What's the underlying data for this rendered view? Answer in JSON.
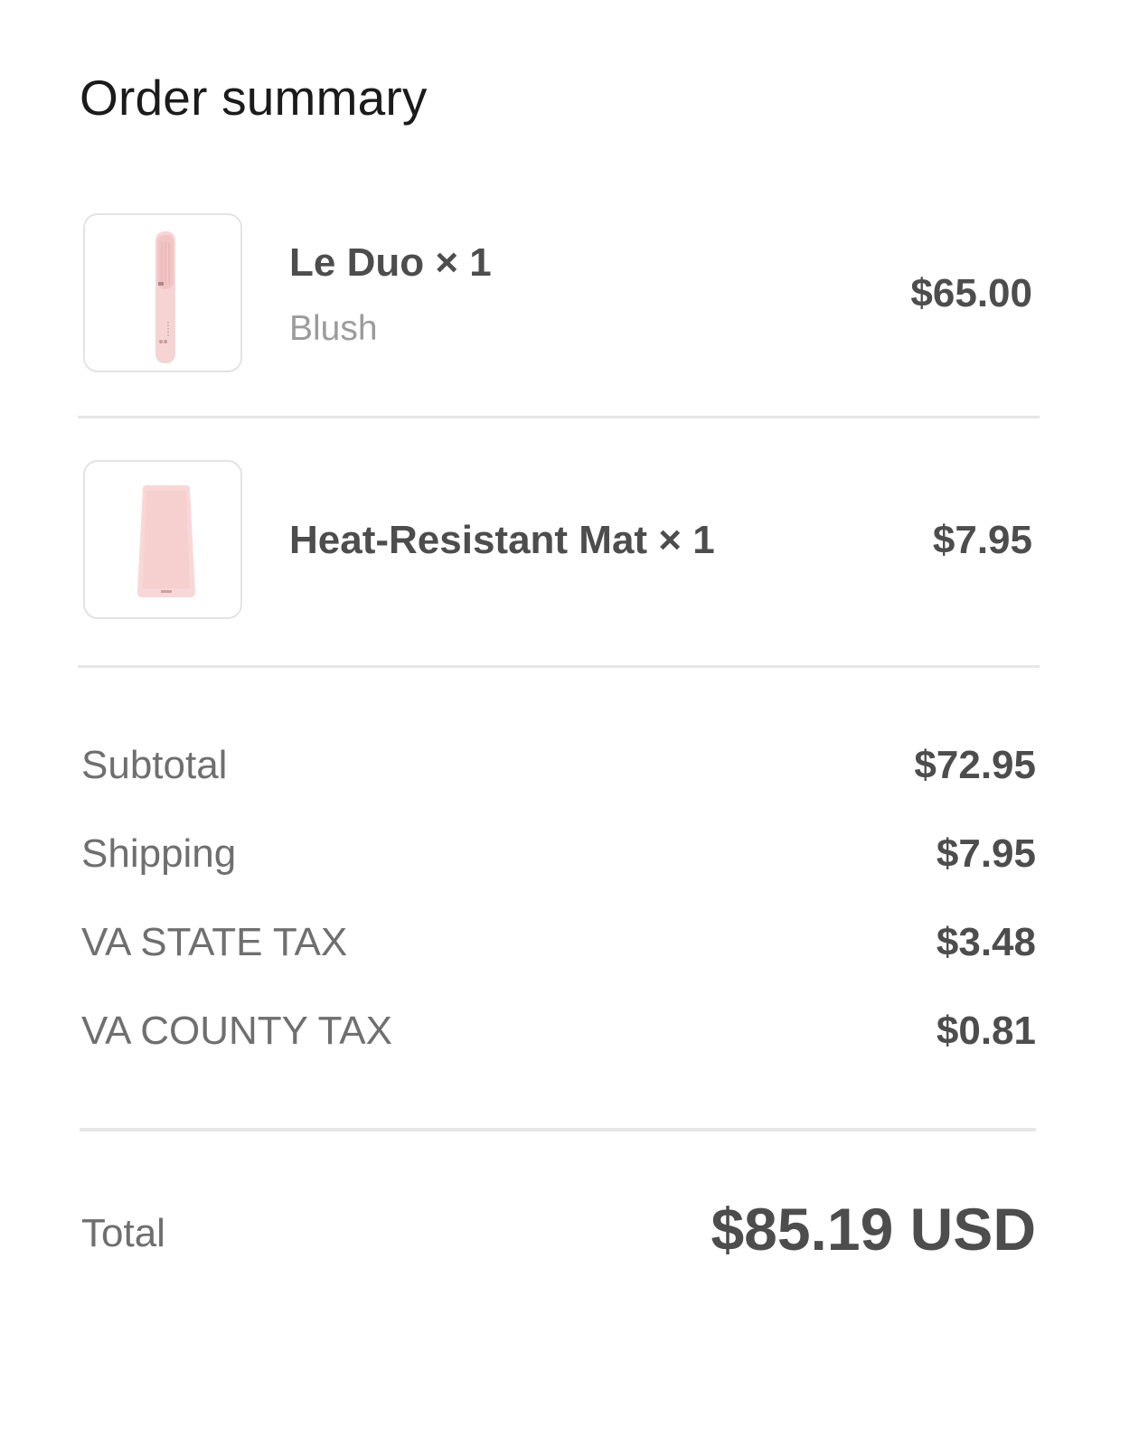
{
  "summary": {
    "title": "Order summary"
  },
  "items": [
    {
      "name": "Le Duo × 1",
      "variant": "Blush",
      "price": "$65.00",
      "product_color": "#f6d4d4"
    },
    {
      "name": "Heat-Resistant Mat × 1",
      "price": "$7.95",
      "product_color": "#f9d7d7"
    }
  ],
  "costs": [
    {
      "label": "Subtotal",
      "value": "$72.95"
    },
    {
      "label": "Shipping",
      "value": "$7.95"
    },
    {
      "label": "VA STATE TAX",
      "value": "$3.48"
    },
    {
      "label": "VA COUNTY TAX",
      "value": "$0.81"
    }
  ],
  "total": {
    "label": "Total",
    "value": "$85.19 USD"
  }
}
